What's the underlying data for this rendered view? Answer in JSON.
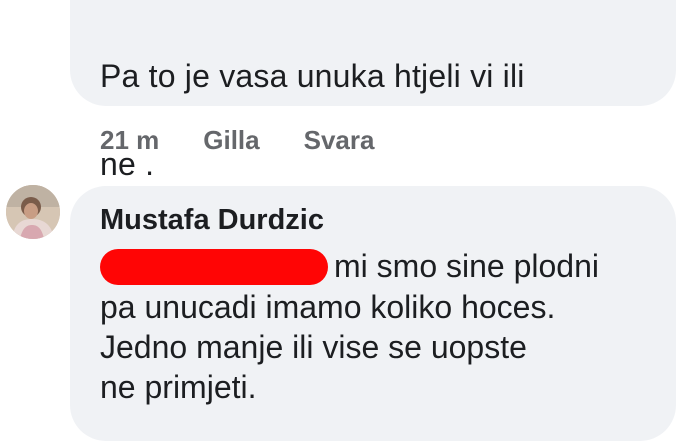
{
  "comment_top": {
    "text_line1": "Pa to je vasa unuka htjeli vi ili",
    "text_line2": "ne ."
  },
  "actions": {
    "time": "21 m",
    "like_label": "Gilla",
    "reply_label": "Svara"
  },
  "comment_reply": {
    "author": "Mustafa Durdzic",
    "lines": [
      "mi smo sine plodni",
      "pa unucadi imamo koliko hoces.",
      "Jedno manje ili vise se uopste",
      "ne primjeti."
    ]
  },
  "colors": {
    "bubble": "#f0f2f5",
    "meta_text": "#65676b",
    "redaction": "#ff0505"
  },
  "icons": {
    "avatar": "user-avatar-photo"
  }
}
